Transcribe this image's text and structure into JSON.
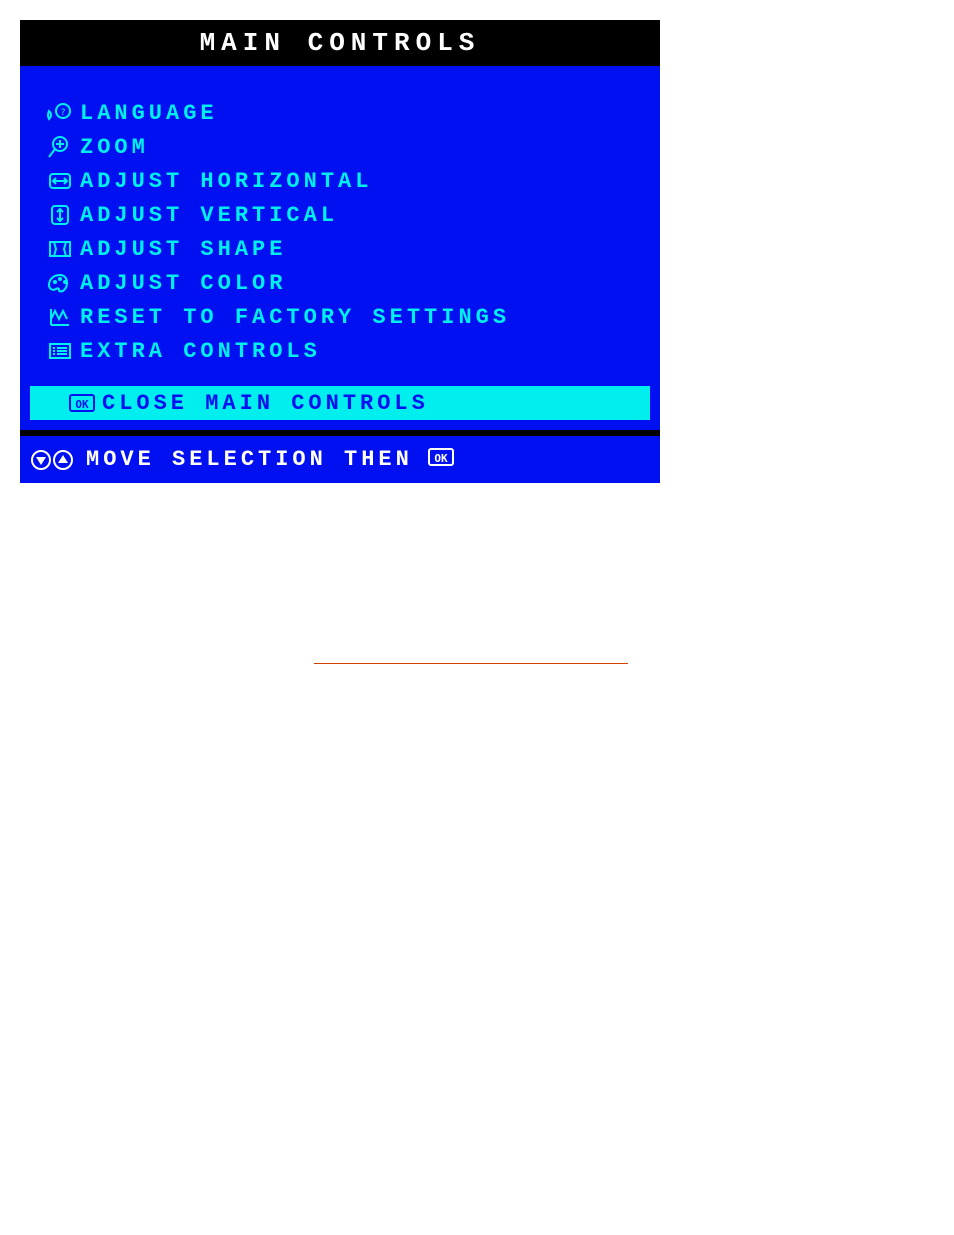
{
  "osd": {
    "title": "MAIN CONTROLS",
    "items": [
      {
        "icon": "language-icon",
        "label": "LANGUAGE"
      },
      {
        "icon": "zoom-icon",
        "label": "ZOOM"
      },
      {
        "icon": "adjust-horizontal-icon",
        "label": "ADJUST HORIZONTAL"
      },
      {
        "icon": "adjust-vertical-icon",
        "label": "ADJUST VERTICAL"
      },
      {
        "icon": "adjust-shape-icon",
        "label": "ADJUST SHAPE"
      },
      {
        "icon": "adjust-color-icon",
        "label": "ADJUST COLOR"
      },
      {
        "icon": "reset-icon",
        "label": "RESET TO FACTORY SETTINGS"
      },
      {
        "icon": "extra-controls-icon",
        "label": "EXTRA CONTROLS"
      }
    ],
    "close": {
      "icon": "ok-icon",
      "label": "CLOSE MAIN CONTROLS"
    },
    "footer_hint": "MOVE SELECTION THEN",
    "footer_icons": {
      "down": "down-arrow-icon",
      "up": "up-arrow-icon",
      "ok": "ok-icon"
    },
    "ok_glyph": "OK"
  },
  "colors": {
    "bg": "#0010f0",
    "cyan": "#00eeee",
    "white": "#ffffff",
    "black": "#000000"
  }
}
